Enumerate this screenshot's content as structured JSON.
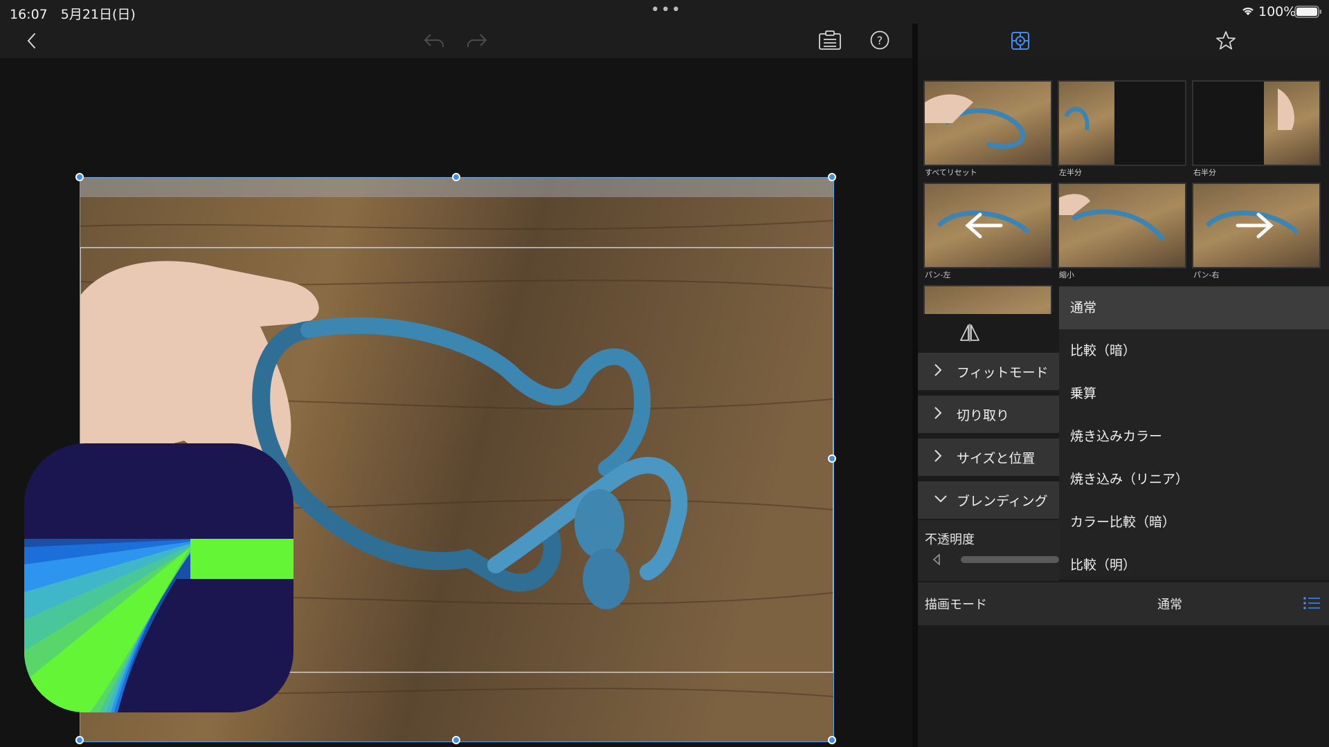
{
  "status_bar": {
    "time_date": "16:07　5月21日(日)",
    "battery": "100%"
  },
  "toolbar": {
    "icons": [
      "back-icon",
      "undo-icon",
      "redo-icon",
      "clipboard-icon",
      "help-icon"
    ]
  },
  "right_toolbar": {
    "tabs": [
      "transform-icon",
      "favorite-icon"
    ]
  },
  "presets": [
    {
      "label": "すべてリセット"
    },
    {
      "label": "左半分"
    },
    {
      "label": "右半分"
    },
    {
      "label": "パン-左"
    },
    {
      "label": "縮小"
    },
    {
      "label": "パン-右"
    }
  ],
  "sections": [
    {
      "label": "フィットモード",
      "expanded": false
    },
    {
      "label": "切り取り",
      "expanded": false
    },
    {
      "label": "サイズと位置",
      "expanded": false
    },
    {
      "label": "ブレンディング",
      "expanded": true
    }
  ],
  "opacity": {
    "label": "不透明度"
  },
  "draw_mode": {
    "label": "描画モード",
    "value": "通常"
  },
  "blend_options": [
    {
      "label": "通常",
      "selected": true
    },
    {
      "label": "比較（暗）",
      "selected": false
    },
    {
      "label": "乗算",
      "selected": false
    },
    {
      "label": "焼き込みカラー",
      "selected": false
    },
    {
      "label": "焼き込み（リニア）",
      "selected": false
    },
    {
      "label": "カラー比較（暗）",
      "selected": false
    },
    {
      "label": "比較（明）",
      "selected": false
    }
  ],
  "colors": {
    "accent": "#3e8ef0",
    "panel_bg": "#1b1b1b",
    "logo_navy": "#1b1650",
    "logo_green": "#63f536"
  }
}
